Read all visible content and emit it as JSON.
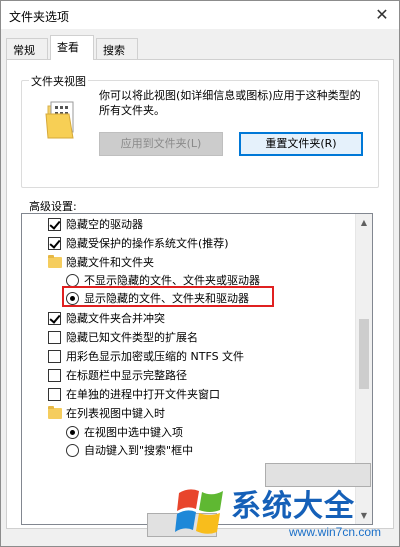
{
  "window": {
    "title": "文件夹选项",
    "close_glyph": "✕"
  },
  "tabs": [
    {
      "label": "常规"
    },
    {
      "label": "查看"
    },
    {
      "label": "搜索"
    }
  ],
  "folder_views": {
    "group_label": "文件夹视图",
    "description": "你可以将此视图(如详细信息或图标)应用于这种类型的所有文件夹。",
    "apply_button": "应用到文件夹(L)",
    "reset_button": "重置文件夹(R)"
  },
  "advanced": {
    "label": "高级设置:",
    "items": [
      {
        "type": "checkbox",
        "checked": true,
        "label": "隐藏空的驱动器"
      },
      {
        "type": "checkbox",
        "checked": true,
        "label": "隐藏受保护的操作系统文件(推荐)"
      },
      {
        "type": "folder",
        "label": "隐藏文件和文件夹"
      },
      {
        "type": "radio",
        "checked": false,
        "label": "不显示隐藏的文件、文件夹或驱动器"
      },
      {
        "type": "radio",
        "checked": true,
        "label": "显示隐藏的文件、文件夹和驱动器"
      },
      {
        "type": "checkbox",
        "checked": true,
        "label": "隐藏文件夹合并冲突"
      },
      {
        "type": "checkbox",
        "checked": false,
        "label": "隐藏已知文件类型的扩展名"
      },
      {
        "type": "checkbox",
        "checked": false,
        "label": "用彩色显示加密或压缩的 NTFS 文件"
      },
      {
        "type": "checkbox",
        "checked": false,
        "label": "在标题栏中显示完整路径"
      },
      {
        "type": "checkbox",
        "checked": false,
        "label": "在单独的进程中打开文件夹窗口"
      },
      {
        "type": "folder",
        "label": "在列表视图中键入时"
      },
      {
        "type": "radio",
        "checked": true,
        "label": "在视图中选中键入项"
      },
      {
        "type": "radio",
        "checked": false,
        "label": "自动键入到\"搜索\"框中"
      }
    ]
  },
  "watermark": {
    "title": "系统大全",
    "url": "www.win7cn.com"
  },
  "colors": {
    "highlight": "#e02020",
    "accent": "#0078d7",
    "watermark": "#1560b8"
  }
}
